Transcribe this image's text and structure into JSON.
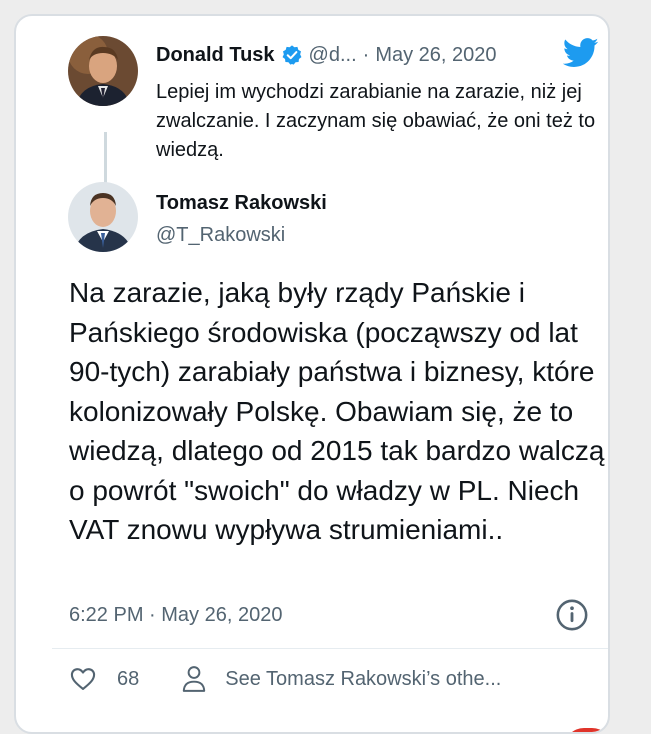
{
  "quoted_tweet": {
    "author_name": "Donald Tusk",
    "author_handle": "@d...",
    "separator": "·",
    "date": "May 26, 2020",
    "text": "Lepiej im wychodzi zarabianie na zarazie, niż jej zwalczanie. I zaczynam się obawiać, że oni też to wiedzą.",
    "verified_icon": "verified-badge-icon",
    "brand_icon": "twitter-bird-icon"
  },
  "tweet": {
    "author_name": "Tomasz Rakowski",
    "author_handle": "@T_Rakowski",
    "text": "Na zarazie, jaką były rządy Pańskie i Pańskiego środowiska (począwszy od lat 90-tych) zarabiały państwa i biznesy, które kolonizowały Polskę. Obawiam się, że to wiedzą, dlatego od 2015 tak bardzo walczą o powrót \"swoich\" do władzy w PL. Niech VAT znowu wypływa strumieniami..",
    "timestamp": "6:22 PM · May 26, 2020",
    "info_icon": "info-icon"
  },
  "actions": {
    "like_icon": "heart-icon",
    "like_count": "68",
    "profile_icon": "person-icon",
    "see_more_label": "See Tomasz Rakowski’s othe..."
  },
  "colors": {
    "primary_text": "#0f1419",
    "secondary_text": "#536471",
    "twitter_blue": "#1d9bf0"
  }
}
